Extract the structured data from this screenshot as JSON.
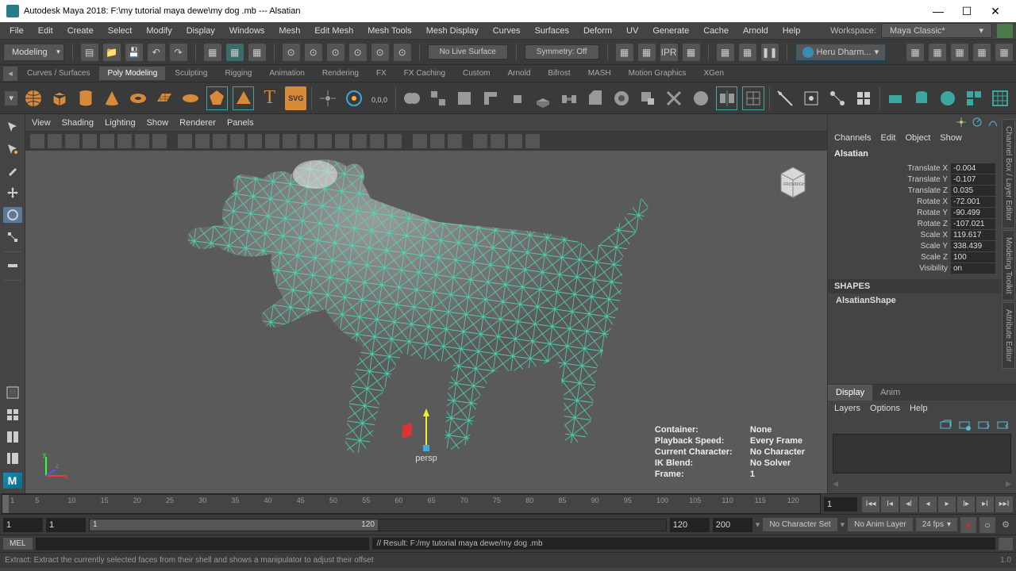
{
  "title": "Autodesk Maya 2018: F:\\my tutorial maya dewe\\my dog .mb  ---  Alsatian",
  "menubar": [
    "File",
    "Edit",
    "Create",
    "Select",
    "Modify",
    "Display",
    "Windows",
    "Mesh",
    "Edit Mesh",
    "Mesh Tools",
    "Mesh Display",
    "Curves",
    "Surfaces",
    "Deform",
    "UV",
    "Generate",
    "Cache",
    "Arnold",
    "Help"
  ],
  "workspace_label": "Workspace:",
  "workspace_value": "Maya Classic*",
  "mode_dropdown": "Modeling",
  "live_surface": "No Live Surface",
  "symmetry": "Symmetry: Off",
  "user": "Heru Dharm...",
  "shelftabs": [
    "Curves / Surfaces",
    "Poly Modeling",
    "Sculpting",
    "Rigging",
    "Animation",
    "Rendering",
    "FX",
    "FX Caching",
    "Custom",
    "Arnold",
    "Bifrost",
    "MASH",
    "Motion Graphics",
    "XGen"
  ],
  "shelftab_active": 1,
  "vpmenu": [
    "View",
    "Shading",
    "Lighting",
    "Show",
    "Renderer",
    "Panels"
  ],
  "hud": {
    "container_lbl": "Container:",
    "container": "None",
    "playback_lbl": "Playback Speed:",
    "playback": "Every Frame",
    "char_lbl": "Current Character:",
    "char": "No Character",
    "ik_lbl": "IK Blend:",
    "ik": "No Solver",
    "frame_lbl": "Frame:",
    "frame": "1"
  },
  "persp": "persp",
  "channel_menu": [
    "Channels",
    "Edit",
    "Object",
    "Show"
  ],
  "object_name": "Alsatian",
  "attrs": [
    {
      "l": "Translate X",
      "v": "-0.004"
    },
    {
      "l": "Translate Y",
      "v": "-0.107"
    },
    {
      "l": "Translate Z",
      "v": "0.035"
    },
    {
      "l": "Rotate X",
      "v": "-72.001"
    },
    {
      "l": "Rotate Y",
      "v": "-90.499"
    },
    {
      "l": "Rotate Z",
      "v": "-107.021"
    },
    {
      "l": "Scale X",
      "v": "119.617"
    },
    {
      "l": "Scale Y",
      "v": "338.439"
    },
    {
      "l": "Scale Z",
      "v": "100"
    },
    {
      "l": "Visibility",
      "v": "on"
    }
  ],
  "shapes_hdr": "SHAPES",
  "shape_name": "AlsatianShape",
  "layer_tabs": [
    "Display",
    "Anim"
  ],
  "layer_menu": [
    "Layers",
    "Options",
    "Help"
  ],
  "side_tabs": [
    "Channel Box / Layer Editor",
    "Modeling Toolkit",
    "Attribute Editor"
  ],
  "viewcube": {
    "front": "FRONT",
    "right": "RIGHT"
  },
  "axes": {
    "x": "x",
    "y": "y",
    "z": "z"
  },
  "timeline_current": "1",
  "range": {
    "start_out": "1",
    "start_in": "1",
    "end_in": "120",
    "end_out": "200",
    "handle_start": "1",
    "handle_end": "120"
  },
  "charset": "No Character Set",
  "animlayer": "No Anim Layer",
  "fps": "24 fps",
  "mel": "MEL",
  "result": "// Result: F:/my tutorial maya dewe/my dog .mb",
  "helpline": "Extract: Extract the currently selected faces from their shell and shows a manipulator to adjust their offset",
  "version": "1.0"
}
